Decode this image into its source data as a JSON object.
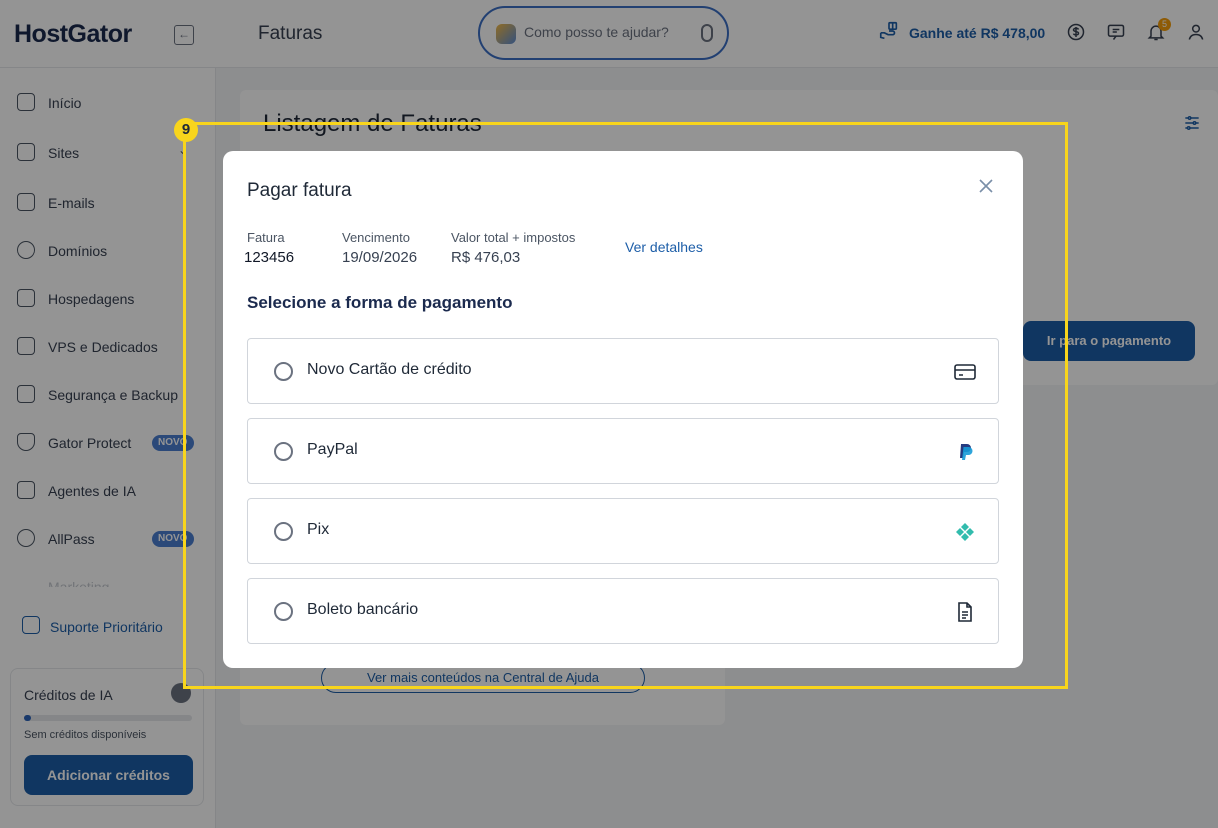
{
  "header": {
    "logo": "HostGator",
    "page_title": "Faturas",
    "assistant_placeholder": "Como posso te ajudar?",
    "earn_text": "Ganhe até R$ 478,00",
    "notification_count": "5"
  },
  "sidebar": {
    "items": [
      {
        "label": "Início",
        "icon": "home-icon"
      },
      {
        "label": "Sites",
        "icon": "sites-icon"
      },
      {
        "label": "E-mails",
        "icon": "mail-icon"
      },
      {
        "label": "Domínios",
        "icon": "globe-icon"
      },
      {
        "label": "Hospedagens",
        "icon": "laptop-icon"
      },
      {
        "label": "VPS e Dedicados",
        "icon": "server-icon"
      },
      {
        "label": "Segurança e Backup",
        "icon": "download-icon"
      },
      {
        "label": "Gator Protect",
        "icon": "shield-icon",
        "badge": "NOVO"
      },
      {
        "label": "Agentes de IA",
        "icon": "robot-icon"
      },
      {
        "label": "AllPass",
        "icon": "sparkle-icon",
        "badge": "NOVO"
      },
      {
        "label": "Marketing",
        "icon": "megaphone-icon"
      }
    ],
    "support_label": "Suporte Prioritário",
    "credits": {
      "title": "Créditos de IA",
      "subtitle": "Sem créditos disponíveis",
      "level": 0.04,
      "button": "Adicionar créditos"
    }
  },
  "main": {
    "title": "Listagem de Faturas",
    "go_to_payment": "Ir para o pagamento",
    "help_link": "Ver mais conteúdos na Central de Ajuda"
  },
  "annotation": {
    "step": "9",
    "color": "#f8d51c"
  },
  "modal": {
    "title": "Pagar fatura",
    "invoice_label": "Fatura",
    "invoice_value": "123456",
    "due_label": "Vencimento",
    "due_value": "19/09/2026",
    "total_label": "Valor total + impostos",
    "total_value": "R$ 476,03",
    "details_link": "Ver detalhes",
    "section_title": "Selecione a forma de pagamento",
    "options": [
      {
        "label": "Novo Cartão de crédito",
        "icon": "credit-card-icon"
      },
      {
        "label": "PayPal",
        "icon": "paypal-icon"
      },
      {
        "label": "Pix",
        "icon": "pix-icon"
      },
      {
        "label": "Boleto bancário",
        "icon": "document-icon"
      }
    ]
  },
  "colors": {
    "brand": "#1d5ea8",
    "pix": "#32bcad",
    "paypal": "#253b80"
  }
}
